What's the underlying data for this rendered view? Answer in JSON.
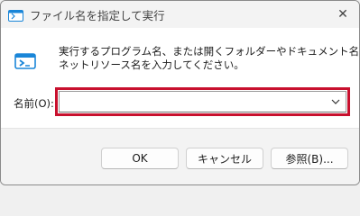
{
  "window": {
    "title": "ファイル名を指定して実行",
    "close_symbol": "✕"
  },
  "content": {
    "description_line1": "実行するプログラム名、または開くフォルダーやドキュメント名、インター",
    "description_line2": "ネットリソース名を入力してください。",
    "name_label": "名前(O):",
    "name_value": "",
    "icon": "run-icon"
  },
  "buttons": {
    "ok": "OK",
    "cancel": "キャンセル",
    "browse": "参照(B)..."
  },
  "colors": {
    "highlight": "#c8102e",
    "accent": "#1a86d8"
  }
}
